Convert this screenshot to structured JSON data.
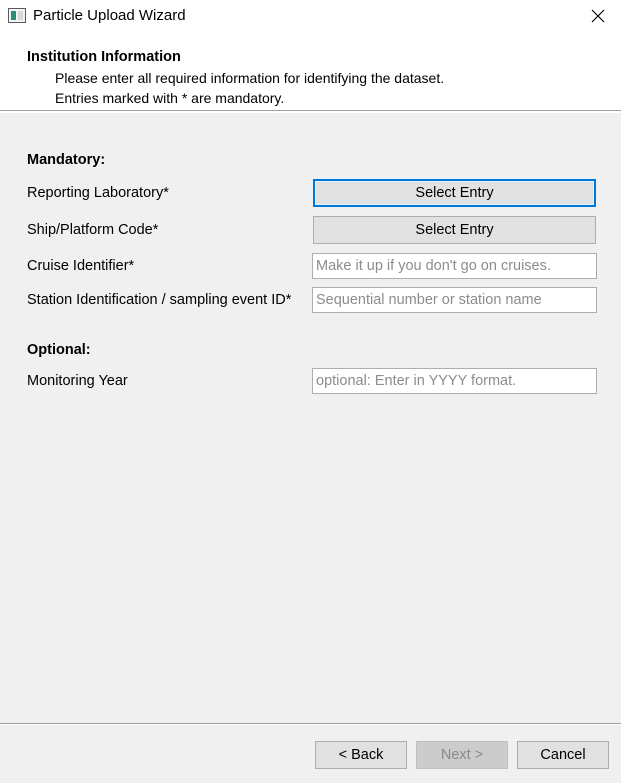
{
  "window": {
    "title": "Particle Upload Wizard",
    "close_icon": "close-icon"
  },
  "header": {
    "title": "Institution Information",
    "line1": "Please enter all required information for identifying the dataset.",
    "line2": "Entries marked with * are mandatory."
  },
  "mandatory": {
    "heading": "Mandatory:",
    "fields": [
      {
        "label": "Reporting Laboratory*",
        "button": "Select Entry"
      },
      {
        "label": "Ship/Platform Code*",
        "button": "Select Entry"
      },
      {
        "label": "Cruise Identifier*",
        "value": "",
        "placeholder": "Make it up if you don't go on cruises."
      },
      {
        "label": "Station Identification / sampling event ID*",
        "value": "",
        "placeholder": "Sequential number or station name"
      }
    ]
  },
  "optional": {
    "heading": "Optional:",
    "fields": [
      {
        "label": "Monitoring Year",
        "value": "",
        "placeholder": "optional: Enter in YYYY format."
      }
    ]
  },
  "footer": {
    "back": "< Back",
    "next": "Next >",
    "cancel": "Cancel"
  },
  "colors": {
    "focus_accent": "#0078d7",
    "window_bg": "#f0f0f0",
    "header_bg": "#ffffff"
  }
}
